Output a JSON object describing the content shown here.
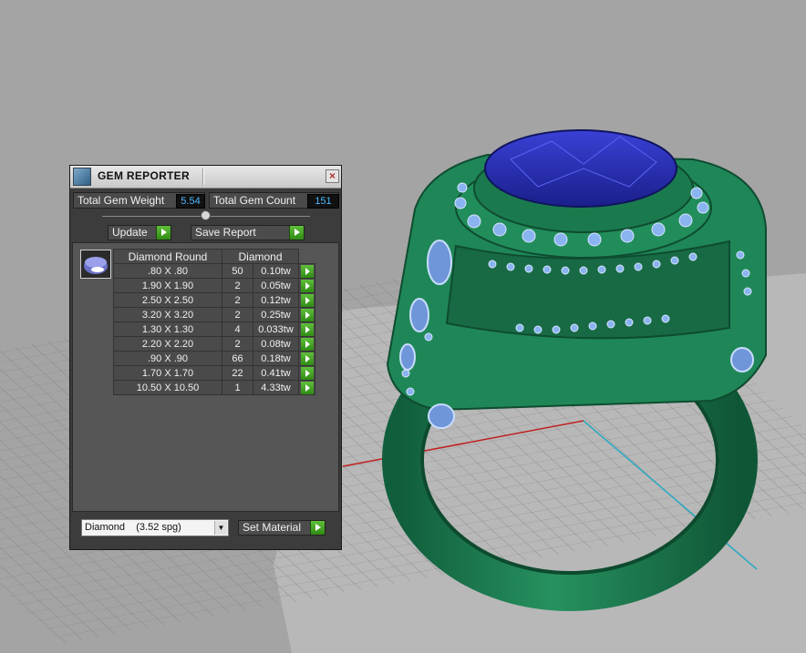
{
  "panel": {
    "title": "GEM REPORTER",
    "close_glyph": "×",
    "total_weight_label": "Total Gem Weight",
    "total_weight_value": "5.54",
    "total_count_label": "Total Gem Count",
    "total_count_value": "151",
    "update_label": "Update",
    "save_report_label": "Save Report",
    "table": {
      "headers": [
        "Diamond Round",
        "Diamond"
      ],
      "rows": [
        {
          "size": ".80 X .80",
          "count": "50",
          "weight": "0.10tw"
        },
        {
          "size": "1.90 X 1.90",
          "count": "2",
          "weight": "0.05tw"
        },
        {
          "size": "2.50 X 2.50",
          "count": "2",
          "weight": "0.12tw"
        },
        {
          "size": "3.20 X 3.20",
          "count": "2",
          "weight": "0.25tw"
        },
        {
          "size": "1.30 X 1.30",
          "count": "4",
          "weight": "0.033tw"
        },
        {
          "size": "2.20 X 2.20",
          "count": "2",
          "weight": "0.08tw"
        },
        {
          "size": ".90 X .90",
          "count": "66",
          "weight": "0.18tw"
        },
        {
          "size": "1.70 X 1.70",
          "count": "22",
          "weight": "0.41tw"
        },
        {
          "size": "10.50 X 10.50",
          "count": "1",
          "weight": "4.33tw"
        }
      ]
    },
    "material_selected": "Diamond    (3.52 spg)",
    "set_material_label": "Set Material"
  },
  "colors": {
    "viewport_bg": "#a4a4a4",
    "ring_green": "#1e7d52",
    "gem_blue": "#2a2fae",
    "pave_blue": "#8ab4f0",
    "accent_green": "#3fa81f"
  }
}
